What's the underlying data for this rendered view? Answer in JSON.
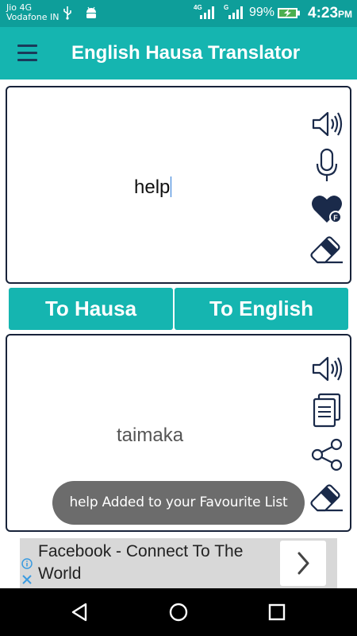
{
  "status_bar": {
    "carrier_1": "Jio 4G",
    "carrier_2": "Vodafone IN",
    "network_1": "4G",
    "network_2": "G",
    "battery_percent": "99%",
    "time": "4:23",
    "time_suffix": "PM",
    "icons": [
      "usb-icon",
      "android-icon",
      "signal-icon",
      "signal-icon",
      "battery-charging-icon"
    ]
  },
  "app_bar": {
    "title": "English Hausa Translator",
    "menu_icon": "hamburger-menu-icon",
    "color": "#15b5b0"
  },
  "input_panel": {
    "text": "help",
    "tools": [
      "speaker-icon",
      "microphone-icon",
      "favourite-heart-icon",
      "eraser-icon"
    ]
  },
  "buttons": {
    "to_hausa": "To Hausa",
    "to_english": "To English"
  },
  "output_panel": {
    "text": "taimaka",
    "tools": [
      "speaker-icon",
      "copy-icon",
      "share-icon",
      "eraser-icon"
    ]
  },
  "toast": {
    "message": "help Added to your Favourite List"
  },
  "ad": {
    "text": "Facebook - Connect To The World",
    "icons": [
      "info-icon",
      "close-icon",
      "chevron-right-icon"
    ]
  },
  "nav_bar": {
    "icons": [
      "back-icon",
      "home-icon",
      "recents-icon"
    ]
  },
  "colors": {
    "accent": "#15b5b0",
    "status_bar": "#0e9e9a",
    "icon_dark": "#1a2a4a",
    "toast_bg": "#6c6c6c"
  }
}
